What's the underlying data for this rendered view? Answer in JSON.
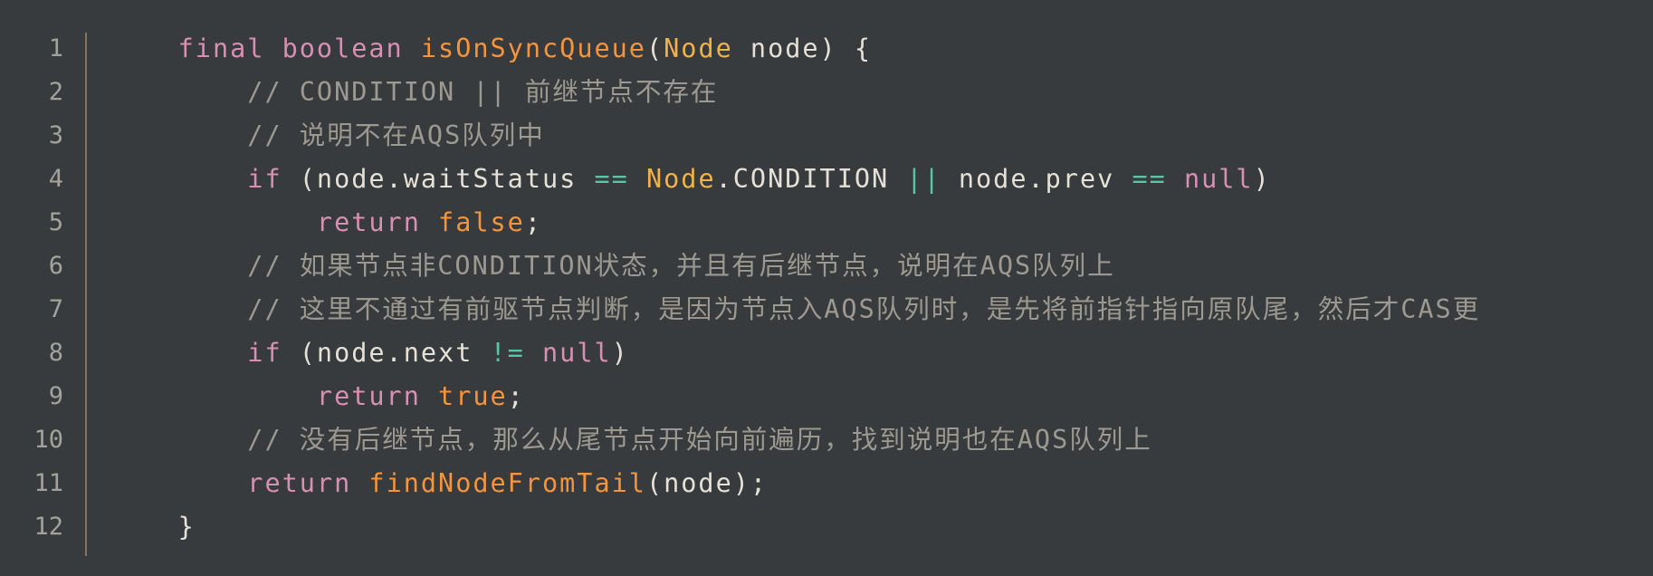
{
  "editor": {
    "line_numbers": [
      "1",
      "2",
      "3",
      "4",
      "5",
      "6",
      "7",
      "8",
      "9",
      "10",
      "11",
      "12"
    ],
    "lines": [
      [
        {
          "t": "    ",
          "c": "plain"
        },
        {
          "t": "final",
          "c": "kw"
        },
        {
          "t": " ",
          "c": "plain"
        },
        {
          "t": "boolean",
          "c": "kw"
        },
        {
          "t": " ",
          "c": "plain"
        },
        {
          "t": "isOnSyncQueue",
          "c": "fn"
        },
        {
          "t": "(",
          "c": "pn"
        },
        {
          "t": "Node",
          "c": "type"
        },
        {
          "t": " node) {",
          "c": "plain"
        }
      ],
      [
        {
          "t": "        ",
          "c": "plain"
        },
        {
          "t": "// CONDITION || 前继节点不存在",
          "c": "cm"
        }
      ],
      [
        {
          "t": "        ",
          "c": "plain"
        },
        {
          "t": "// 说明不在AQS队列中",
          "c": "cm"
        }
      ],
      [
        {
          "t": "        ",
          "c": "plain"
        },
        {
          "t": "if",
          "c": "kw"
        },
        {
          "t": " (node.waitStatus ",
          "c": "plain"
        },
        {
          "t": "==",
          "c": "op"
        },
        {
          "t": " ",
          "c": "plain"
        },
        {
          "t": "Node",
          "c": "type"
        },
        {
          "t": ".CONDITION ",
          "c": "plain"
        },
        {
          "t": "||",
          "c": "op"
        },
        {
          "t": " node.prev ",
          "c": "plain"
        },
        {
          "t": "==",
          "c": "op"
        },
        {
          "t": " ",
          "c": "plain"
        },
        {
          "t": "null",
          "c": "kw"
        },
        {
          "t": ")",
          "c": "pn"
        }
      ],
      [
        {
          "t": "            ",
          "c": "plain"
        },
        {
          "t": "return",
          "c": "kw"
        },
        {
          "t": " ",
          "c": "plain"
        },
        {
          "t": "false",
          "c": "fn"
        },
        {
          "t": ";",
          "c": "pn"
        }
      ],
      [
        {
          "t": "        ",
          "c": "plain"
        },
        {
          "t": "// 如果节点非CONDITION状态，并且有后继节点，说明在AQS队列上",
          "c": "cm"
        }
      ],
      [
        {
          "t": "        ",
          "c": "plain"
        },
        {
          "t": "// 这里不通过有前驱节点判断，是因为节点入AQS队列时，是先将前指针指向原队尾，然后才CAS更",
          "c": "cm"
        }
      ],
      [
        {
          "t": "        ",
          "c": "plain"
        },
        {
          "t": "if",
          "c": "kw"
        },
        {
          "t": " (node.next ",
          "c": "plain"
        },
        {
          "t": "!=",
          "c": "op"
        },
        {
          "t": " ",
          "c": "plain"
        },
        {
          "t": "null",
          "c": "kw"
        },
        {
          "t": ")",
          "c": "pn"
        }
      ],
      [
        {
          "t": "            ",
          "c": "plain"
        },
        {
          "t": "return",
          "c": "kw"
        },
        {
          "t": " ",
          "c": "plain"
        },
        {
          "t": "true",
          "c": "fn"
        },
        {
          "t": ";",
          "c": "pn"
        }
      ],
      [
        {
          "t": "        ",
          "c": "plain"
        },
        {
          "t": "// 没有后继节点，那么从尾节点开始向前遍历，找到说明也在AQS队列上",
          "c": "cm"
        }
      ],
      [
        {
          "t": "        ",
          "c": "plain"
        },
        {
          "t": "return",
          "c": "kw"
        },
        {
          "t": " ",
          "c": "plain"
        },
        {
          "t": "findNodeFromTail",
          "c": "fn"
        },
        {
          "t": "(node);",
          "c": "plain"
        }
      ],
      [
        {
          "t": "    ",
          "c": "plain"
        },
        {
          "t": "}",
          "c": "plain"
        }
      ]
    ]
  },
  "colors": {
    "background": "#383b3d",
    "keyword": "#d78fb3",
    "function": "#f3943f",
    "type": "#f2b24a",
    "operator": "#55c6a6",
    "comment": "#9d9990",
    "text": "#e6e1d6",
    "line_number": "#a5a29b",
    "gutter_divider": "#8a7350"
  }
}
